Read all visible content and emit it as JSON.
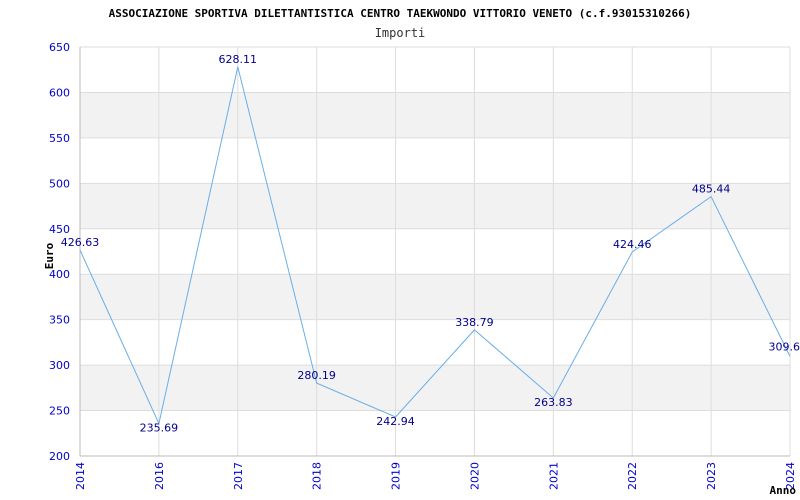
{
  "title": "ASSOCIAZIONE SPORTIVA DILETTANTISTICA CENTRO TAEKWONDO VITTORIO VENETO (c.f.93015310266)",
  "subtitle": "Importi",
  "colors": {
    "line": "#6aaee8",
    "label": "#00008b",
    "tick": "#0000cc",
    "band": "#f2f2f2",
    "grid": "#dddddd",
    "axis": "#bbbbbb"
  },
  "chart_data": {
    "type": "line",
    "title": "ASSOCIAZIONE SPORTIVA DILETTANTISTICA CENTRO TAEKWONDO VITTORIO VENETO (c.f.93015310266)",
    "subtitle": "Importi",
    "xlabel": "Anno",
    "ylabel": "Euro",
    "categories": [
      "2014",
      "2016",
      "2017",
      "2018",
      "2019",
      "2020",
      "2021",
      "2022",
      "2023",
      "2024"
    ],
    "values": [
      426.63,
      235.69,
      628.11,
      280.19,
      242.94,
      338.79,
      263.83,
      424.46,
      485.44,
      309.6
    ],
    "data_labels": [
      "426.63",
      "235.69",
      "628.11",
      "280.19",
      "242.94",
      "338.79",
      "263.83",
      "424.46",
      "485.44",
      "309.6"
    ],
    "ylim": [
      200,
      650
    ],
    "yticks": [
      200,
      250,
      300,
      350,
      400,
      450,
      500,
      550,
      600,
      650
    ],
    "grid": true,
    "legend": "none"
  }
}
